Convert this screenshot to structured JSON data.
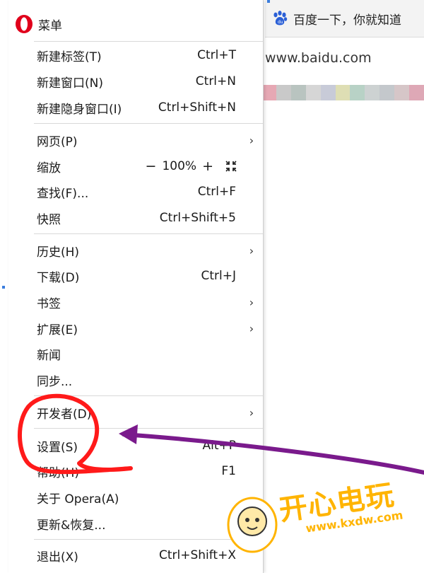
{
  "browser": {
    "tab_title": "百度一下，你就知道",
    "address": "www.baidu.com",
    "bookmark_colors": [
      "#e6a8b4",
      "#c9c9c9",
      "#b9c4c0",
      "#d6d6d6",
      "#c8cbd8",
      "#dedeb4",
      "#b8d2c6",
      "#cdd2d2",
      "#c4c8cc",
      "#d6c6c8",
      "#dea8b6"
    ]
  },
  "menu": {
    "title": "菜单",
    "items": {
      "new_tab": {
        "label": "新建标签(T)",
        "shortcut": "Ctrl+T"
      },
      "new_window": {
        "label": "新建窗口(N)",
        "shortcut": "Ctrl+N"
      },
      "new_private": {
        "label": "新建隐身窗口(I)",
        "shortcut": "Ctrl+Shift+N"
      },
      "page": {
        "label": "网页(P)"
      },
      "zoom": {
        "label": "缩放",
        "minus": "−",
        "value": "100%",
        "plus": "+"
      },
      "find": {
        "label": "查找(F)...",
        "shortcut": "Ctrl+F"
      },
      "snapshot": {
        "label": "快照",
        "shortcut": "Ctrl+Shift+5"
      },
      "history": {
        "label": "历史(H)"
      },
      "downloads": {
        "label": "下载(D)",
        "shortcut": "Ctrl+J"
      },
      "bookmarks": {
        "label": "书签"
      },
      "extensions": {
        "label": "扩展(E)"
      },
      "news": {
        "label": "新闻"
      },
      "sync": {
        "label": "同步..."
      },
      "developer": {
        "label": "开发者(D)"
      },
      "settings": {
        "label": "设置(S)",
        "shortcut": "Alt+P"
      },
      "help": {
        "label": "帮助(H)",
        "shortcut": "F1"
      },
      "about": {
        "label": "关于 Opera(A)"
      },
      "update": {
        "label": "更新&恢复..."
      },
      "exit": {
        "label": "退出(X)",
        "shortcut": "Ctrl+Shift+X"
      }
    }
  },
  "watermark": {
    "brand": "开心电玩",
    "url": "www.kxdw.com"
  },
  "colors": {
    "opera_red": "#e0001b",
    "annotation_red": "#ff1a1a",
    "arrow_purple": "#7a1a8c",
    "watermark_orange": "#ffb400"
  },
  "icons": [
    "baidu-paw-icon",
    "opera-logo-icon",
    "chevron-right-icon",
    "fullscreen-icon"
  ]
}
